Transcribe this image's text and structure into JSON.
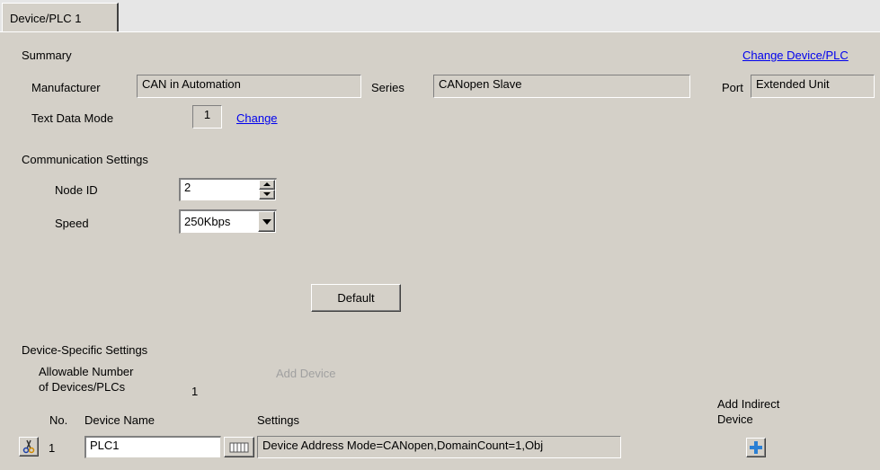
{
  "tab": {
    "label": "Device/PLC 1"
  },
  "summary": {
    "heading": "Summary",
    "change_link": "Change Device/PLC",
    "manufacturer_label": "Manufacturer",
    "manufacturer_value": "CAN in Automation",
    "series_label": "Series",
    "series_value": "CANopen Slave",
    "port_label": "Port",
    "port_value": "Extended Unit",
    "text_mode_label": "Text Data Mode",
    "text_mode_value": "1",
    "text_mode_change": "Change"
  },
  "comm": {
    "heading": "Communication Settings",
    "node_id_label": "Node ID",
    "node_id_value": "2",
    "speed_label": "Speed",
    "speed_value": "250Kbps",
    "default_button": "Default"
  },
  "device_specific": {
    "heading": "Device-Specific Settings",
    "allowable_line1": "Allowable Number",
    "allowable_line2": "of Devices/PLCs",
    "allowable_value": "1",
    "add_device": "Add Device",
    "add_indirect_line1": "Add Indirect",
    "add_indirect_line2": "Device",
    "col_no": "No.",
    "col_device_name": "Device Name",
    "col_settings": "Settings",
    "rows": [
      {
        "no": "1",
        "device_name": "PLC1",
        "settings": "Device Address Mode=CANopen,DomainCount=1,Obj"
      }
    ]
  },
  "colors": {
    "background": "#d4d0c8",
    "link": "#0000ee",
    "disabled_text": "#a0a0a0",
    "add_icon": "#2a7fd4"
  }
}
